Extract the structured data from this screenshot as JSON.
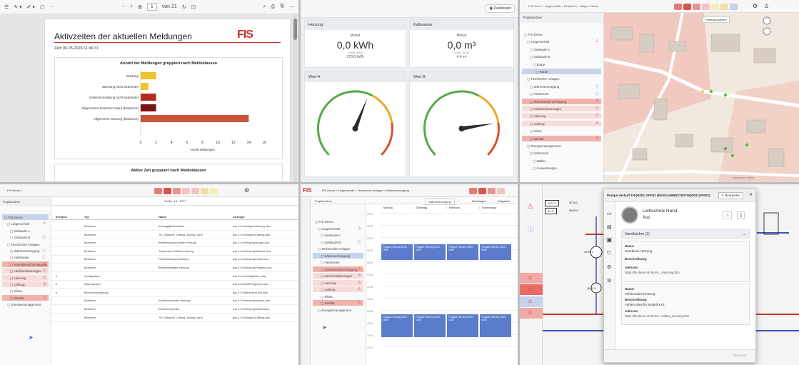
{
  "report": {
    "toolbar": {
      "page_input": "1",
      "page_of": "von 21",
      "minus": "−",
      "plus": "+",
      "more": "···"
    },
    "title": "Aktivzeiten der aktuellen Meldungen",
    "logo": "FIS",
    "timestamp": "Zeit: 06.05.2024 11:46:31",
    "chart1_title": "Anzahl der Meldungen gruppiert nach Meldeklassen",
    "chart2_title": "Aktive Zeit gruppiert nach Meldeklassen"
  },
  "chart_data": {
    "type": "bar",
    "orientation": "horizontal",
    "title": "Anzahl der Meldungen gruppiert nach Meldeklassen",
    "categories": [
      "Wartung",
      "Warnung nicht bearbeitet",
      "Gefahrenmeldung nicht bearbeitet",
      "Allgemeiner kritischer Alarm (klassisch)",
      "Allgemeine Störung (klassisch)"
    ],
    "values": [
      2,
      1,
      2,
      2,
      14
    ],
    "colors": [
      "#f2c12e",
      "#f2c12e",
      "#b22d1e",
      "#7a1512",
      "#c9543a"
    ],
    "xlim": [
      0,
      16
    ],
    "xticks": [
      "0",
      "2",
      "4",
      "6",
      "8",
      "10",
      "12",
      "14",
      "16"
    ],
    "xlabel": "Anzahl Meldungen"
  },
  "dashboard": {
    "button": "Dashboard",
    "tiles": [
      {
        "title": "Heizung",
        "period": "Monat",
        "value": "0,0 kWh",
        "sub": "270,0 kWh",
        "subcap": "Letzter Monat"
      },
      {
        "title": "Kaltwasser",
        "period": "Monat",
        "value": "0,0 m³",
        "sub": "4,4 m³",
        "subcap": "Letzter Monat"
      }
    ],
    "gauges": [
      {
        "title": "Wert A",
        "level": 0.58
      },
      {
        "title": "Wert B",
        "level": 0.8
      }
    ]
  },
  "map": {
    "breadcrumb": "FIS Demo  >  Liegenschaft  >  Bestand 6  >  Etage  >  Raum",
    "panel_title": "Projektordner",
    "items": [
      "FIS Demo",
      "Liegenschaft",
      "Gebäude A",
      "Gebäude B",
      "Etage",
      "Raum",
      "Technische Anlagen",
      "Wärmeerzeugung",
      "Heizkreise",
      "Alarmbenachrichtigung",
      "Heizkreisstörungen",
      "Heizung",
      "Lüftung",
      "Klima",
      "Sanitär",
      "Energiemanagement",
      "Verbrauch",
      "Zähler",
      "Auswertungen"
    ],
    "layer_label": "Hintergrundkarte",
    "street": "Kattenbrook Straße"
  },
  "list": {
    "breadcrumb": "FIS Demo  >",
    "header_count": "Treffer: 13 / 1377",
    "panel_title": "Projektordner",
    "col_headers": [
      "Ereignis",
      "Typ",
      "Name",
      "Anzeiger"
    ],
    "tree": [
      "FIS Demo",
      "Liegenschaft",
      "Gebäude A",
      "Gebäude B",
      "Technische Anlagen",
      "Wärmeerzeugung",
      "Heizkreise",
      "Alarmbenachrichtigung",
      "Heizkreisstörungen",
      "Heizung",
      "Lüftung",
      "Klima",
      "Sanitär",
      "Energiemanagement"
    ],
    "rows": [
      {
        "typ": "Bedienen",
        "name": "Anhängigkeitsmelden",
        "ort": "aus 0.0.h/Anlagen/Anhang.ukw"
      },
      {
        "typ": "Bedienen",
        "name": "TB_Gebäude_Lüftung_Aufzug_vorm",
        "ort": "aus 0.0.h/Anlagen/Lüftung.ukw"
      },
      {
        "typ": "Bedienen",
        "name": "Betriebsstundenzähler Heizung",
        "ort": "aus 0.0.h/Heizung/Anlage.ukw"
      },
      {
        "typ": "Bedienen",
        "name": "Temperatur-Sollwert Heizung",
        "ort": "aus 0.0.h/Heizung/Sollwert.ukw"
      },
      {
        "typ": "Bedienen",
        "name": "Fehlermeldung Heizung 1",
        "ort": "aus 0.0.h/Heizung/Fehler.ukw"
      },
      {
        "typ": "Bedienen",
        "name": "Betriebsfreigabe Heizung",
        "ort": "aus 0.0.h/Heizung/Freigabe.ukw"
      },
      {
        "typ": "Konfiguration",
        "name": "",
        "ort": "aus 0.0.h/Konfig/Daten.ukw"
      },
      {
        "typ": "Zeitprogramm",
        "name": "",
        "ort": "aus 0.0.h/Zeit/Programm.ukw"
      },
      {
        "typ": "Benutzerverwaltung",
        "name": "",
        "ort": "aus 0.0.h/Benutzer/Liste.ukw"
      },
      {
        "typ": "Bedienen",
        "name": "Außentemperatur Heizung",
        "ort": "aus 0.0.h/Heizung/Aussen.ukw"
      },
      {
        "typ": "Bedienen",
        "name": "Kesseltemperatur",
        "ort": "aus 0.0.h/Heizung/Kessel.ukw"
      },
      {
        "typ": "Bedienen",
        "name": "TB_Gebäude_Lüftung_Aufzug_vorm",
        "ort": "aus 0.0.h/Anlagen/Lüftung.ukw"
      }
    ]
  },
  "calendar": {
    "breadcrumb": "FIS Demo  >  Liegenschaft  >  Technische Anlagen  >  Wärmeerzeugung",
    "tabs": [
      "Projektordner",
      "Wärmeerzeugung",
      "Meldungen",
      "Aufgaben"
    ],
    "days": [
      "Montag",
      "Dienstag",
      "Mittwoch",
      "Donnerstag"
    ],
    "tree": [
      "FIS Demo",
      "Liegenschaft",
      "Gebäude A",
      "Gebäude B",
      "Technische Anlagen",
      "Wärmeerzeugung",
      "Heizkreise",
      "Alarmbenachrichtigung",
      "Heizkreisstörungen",
      "Heizung",
      "Lüftung",
      "Klima",
      "Sanitär",
      "Energiemanagement"
    ],
    "times": [
      "00:00",
      "02:00",
      "04:00",
      "06:00",
      "08:00",
      "10:00",
      "12:00",
      "14:00",
      "16:00",
      "18:00",
      "20:00",
      "22:00"
    ],
    "event_text": "Freigabe Heizung 06:00 - 18:00"
  },
  "dialog": {
    "title": "Pumpe Verlauf THQ0001 GP002 (MG01vsBB03T00THQ0001GP002)",
    "edit_label": "Bearbeiten",
    "close": "✕",
    "name": "Leittechnik Hand",
    "state": "Aus",
    "section": "Handbücher (2)",
    "docs": [
      {
        "name_label": "Name:",
        "name": "Handbuch Heizung",
        "desc_label": "Beschreibung:",
        "addr_label": "Adresse:",
        "url": "https://fis-demo-nb.fermo.../Heizung.htm"
      },
      {
        "name_label": "Name:",
        "name": "Fehlercodes Heizung",
        "desc_label": "Beschreibung:",
        "desc": "Fehlercodes für Modell XYZ",
        "addr_label": "Adresse:",
        "url": "https://fis-demo-nb.fermo...Codes_Heizung.htm"
      }
    ],
    "footer_button": "Speichern",
    "schema_labels": [
      "GP001",
      "QN001",
      "100 °C",
      "BT002",
      "BM003",
      "60 %"
    ]
  }
}
